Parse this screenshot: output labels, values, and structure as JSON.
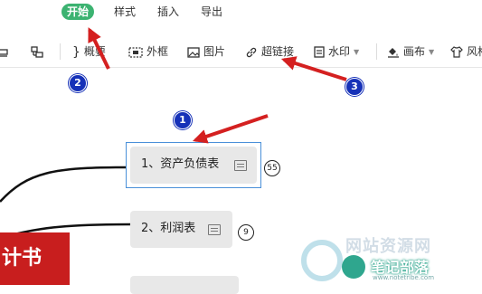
{
  "menu": {
    "items": [
      {
        "label": "开始",
        "active": true
      },
      {
        "label": "样式"
      },
      {
        "label": "插入"
      },
      {
        "label": "导出"
      }
    ]
  },
  "toolbar": {
    "summary": "概要",
    "frame": "外框",
    "image": "图片",
    "hyperlink": "超链接",
    "watermark": "水印",
    "canvas": "画布",
    "style": "风格"
  },
  "nodes": [
    {
      "label": "1、资产负债表",
      "count": "55",
      "selected": true
    },
    {
      "label": "2、利润表",
      "count": "9"
    }
  ],
  "root": {
    "label": "计书"
  },
  "annotations": [
    "1",
    "2",
    "3"
  ],
  "watermark": {
    "site_cn": "笔记部落",
    "site_url": "www.notetribe.com",
    "faint_text": "网站资源网"
  },
  "colors": {
    "accent": "#3cb371",
    "arrow": "#d42020",
    "badge": "#1631b8",
    "root": "#c81e1e",
    "selection": "#4a90d9"
  }
}
